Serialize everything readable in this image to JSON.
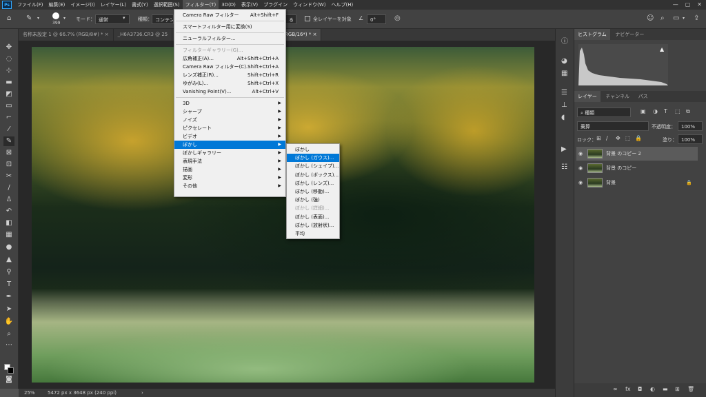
{
  "menubar": {
    "app_logo": "Ps",
    "items": [
      "ファイル(F)",
      "編集(E)",
      "イメージ(I)",
      "レイヤー(L)",
      "書式(Y)",
      "選択範囲(S)",
      "フィルター(T)",
      "3D(D)",
      "表示(V)",
      "プラグイン",
      "ウィンドウ(W)",
      "ヘルプ(H)"
    ],
    "active_index": 6
  },
  "options": {
    "brush_size": "399",
    "mode_label": "モード：",
    "mode_value": "通常",
    "type_label": "種類：",
    "type_value": "コンテン",
    "partial_btn": "る",
    "all_layers": "全レイヤーを対象",
    "angle_value": "0°"
  },
  "tabs": [
    {
      "label": "名称未設定 1 @ 66.7% (RGB/8#) *",
      "close": "×"
    },
    {
      "label": "_H6A3736.CR3 @ 25",
      "close": ""
    },
    {
      "label": "3 @ 25% (背景 のコピー 2, RGB/16*) *",
      "close": "×"
    }
  ],
  "filter_menu": {
    "items": [
      {
        "label": "Camera Raw フィルター",
        "shortcut": "Alt+Shift+F",
        "disabled": false,
        "submenu": false
      },
      {
        "sep": true
      },
      {
        "label": "スマートフィルター用に変換(S)",
        "shortcut": "",
        "disabled": false,
        "submenu": false
      },
      {
        "sep": true
      },
      {
        "label": "ニューラルフィルター...",
        "shortcut": "",
        "disabled": false,
        "submenu": false
      },
      {
        "sep": true
      },
      {
        "label": "フィルターギャラリー(G)...",
        "shortcut": "",
        "disabled": true,
        "submenu": false
      },
      {
        "label": "広角補正(A)...",
        "shortcut": "Alt+Shift+Ctrl+A",
        "disabled": false,
        "submenu": false
      },
      {
        "label": "Camera Raw フィルター(C)...",
        "shortcut": "Shift+Ctrl+A",
        "disabled": false,
        "submenu": false
      },
      {
        "label": "レンズ補正(R)...",
        "shortcut": "Shift+Ctrl+R",
        "disabled": false,
        "submenu": false
      },
      {
        "label": "ゆがみ(L)...",
        "shortcut": "Shift+Ctrl+X",
        "disabled": false,
        "submenu": false
      },
      {
        "label": "Vanishing Point(V)...",
        "shortcut": "Alt+Ctrl+V",
        "disabled": false,
        "submenu": false
      },
      {
        "sep": true
      },
      {
        "label": "3D",
        "shortcut": "",
        "disabled": false,
        "submenu": true
      },
      {
        "label": "シャープ",
        "shortcut": "",
        "disabled": false,
        "submenu": true
      },
      {
        "label": "ノイズ",
        "shortcut": "",
        "disabled": false,
        "submenu": true
      },
      {
        "label": "ピクセレート",
        "shortcut": "",
        "disabled": false,
        "submenu": true
      },
      {
        "label": "ビデオ",
        "shortcut": "",
        "disabled": false,
        "submenu": true
      },
      {
        "label": "ぼかし",
        "shortcut": "",
        "disabled": false,
        "submenu": true,
        "highlight": true
      },
      {
        "label": "ぼかしギャラリー",
        "shortcut": "",
        "disabled": false,
        "submenu": true
      },
      {
        "label": "表現手法",
        "shortcut": "",
        "disabled": false,
        "submenu": true
      },
      {
        "label": "描画",
        "shortcut": "",
        "disabled": false,
        "submenu": true
      },
      {
        "label": "変形",
        "shortcut": "",
        "disabled": false,
        "submenu": true
      },
      {
        "label": "その他",
        "shortcut": "",
        "disabled": false,
        "submenu": true
      }
    ]
  },
  "blur_menu": {
    "items": [
      {
        "label": "ぼかし",
        "disabled": false
      },
      {
        "label": "ぼかし (ガウス)...",
        "disabled": false,
        "highlight": true
      },
      {
        "label": "ぼかし (シェイプ)...",
        "disabled": false
      },
      {
        "label": "ぼかし (ボックス)...",
        "disabled": false
      },
      {
        "label": "ぼかし (レンズ)...",
        "disabled": false
      },
      {
        "label": "ぼかし (移動)...",
        "disabled": false
      },
      {
        "label": "ぼかし (強)",
        "disabled": false
      },
      {
        "label": "ぼかし (詳細)...",
        "disabled": true
      },
      {
        "label": "ぼかし (表面)...",
        "disabled": false
      },
      {
        "label": "ぼかし (放射状)...",
        "disabled": false
      },
      {
        "label": "平均",
        "disabled": false
      }
    ]
  },
  "status": {
    "zoom": "25%",
    "doc_info": "5472 px x 3648 px (240 ppi)"
  },
  "panels": {
    "top_tabs": [
      "ヒストグラム",
      "ナビゲーター"
    ],
    "layer_tabs": [
      "レイヤー",
      "チャンネル",
      "パス"
    ],
    "kind_filter": "種類",
    "blend_mode": "乗算",
    "opacity_label": "不透明度：",
    "opacity_value": "100%",
    "lock_label": "ロック：",
    "fill_label": "塗り：",
    "fill_value": "100%",
    "layers": [
      {
        "name": "背景 のコピー 2",
        "selected": true,
        "locked": false
      },
      {
        "name": "背景 のコピー",
        "selected": false,
        "locked": false
      },
      {
        "name": "背景",
        "selected": false,
        "locked": true
      }
    ]
  }
}
